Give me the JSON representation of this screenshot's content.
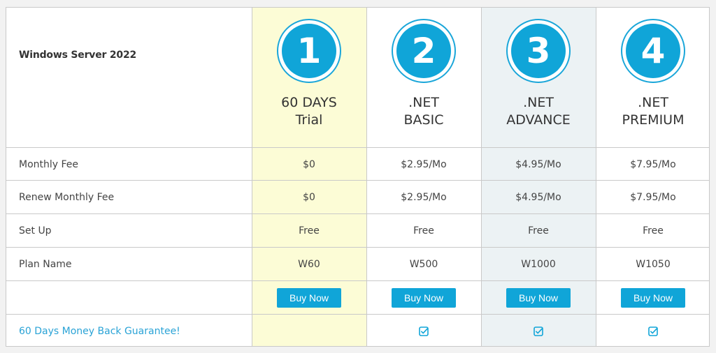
{
  "product": "Windows Server 2022",
  "plans": [
    {
      "number": "1",
      "name_line1": "60 DAYS",
      "name_line2": "Trial",
      "monthly_fee": "$0",
      "renew_fee": "$0",
      "setup": "Free",
      "plan_name": "W60",
      "buy_label": "Buy Now",
      "money_back": false
    },
    {
      "number": "2",
      "name_line1": ".NET",
      "name_line2": "BASIC",
      "monthly_fee": "$2.95/Mo",
      "renew_fee": "$2.95/Mo",
      "setup": "Free",
      "plan_name": "W500",
      "buy_label": "Buy Now",
      "money_back": true
    },
    {
      "number": "3",
      "name_line1": ".NET",
      "name_line2": "ADVANCE",
      "monthly_fee": "$4.95/Mo",
      "renew_fee": "$4.95/Mo",
      "setup": "Free",
      "plan_name": "W1000",
      "buy_label": "Buy Now",
      "money_back": true
    },
    {
      "number": "4",
      "name_line1": ".NET",
      "name_line2": "PREMIUM",
      "monthly_fee": "$7.95/Mo",
      "renew_fee": "$7.95/Mo",
      "setup": "Free",
      "plan_name": "W1050",
      "buy_label": "Buy Now",
      "money_back": true
    }
  ],
  "rows": {
    "monthly_fee": "Monthly Fee",
    "renew_fee": "Renew Monthly Fee",
    "setup": "Set Up",
    "plan_name": "Plan Name",
    "guarantee": "60 Days Money Back Guarantee!"
  },
  "colors": {
    "accent": "#10a5d8",
    "trial_bg": "#fcfcd6",
    "advance_bg": "#ecf2f4"
  },
  "icons": {
    "check": "check-square-icon"
  }
}
